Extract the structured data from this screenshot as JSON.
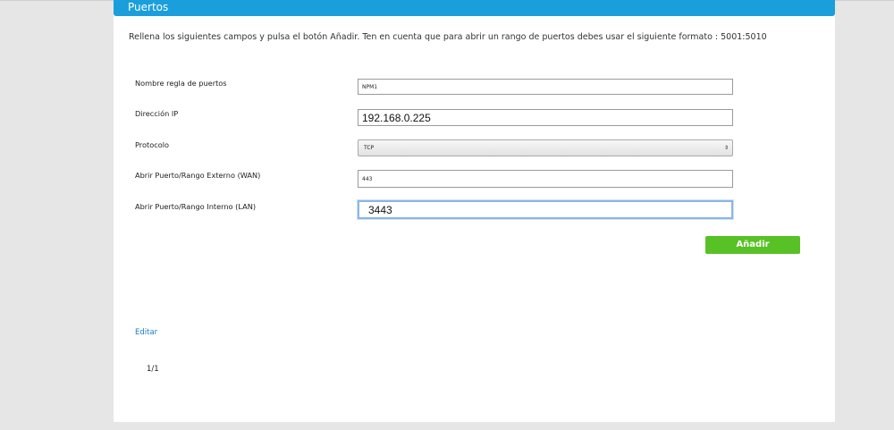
{
  "header": {
    "title": "Puertos"
  },
  "intro_text": "Rellena los siguientes campos y pulsa el botón Añadir. Ten en cuenta que para abrir un rango de puertos debes usar el siguiente formato : 5001:5010",
  "form": {
    "rule_name": {
      "label": "Nombre regla de puertos",
      "value": "NPM1"
    },
    "ip_address": {
      "label": "Dirección IP",
      "value": "192.168.0.225"
    },
    "protocol": {
      "label": "Protocolo",
      "selected": "TCP",
      "arrow": "⇕"
    },
    "external_port": {
      "label": "Abrir Puerto/Rango Externo (WAN)",
      "value": "443"
    },
    "internal_port": {
      "label": "Abrir Puerto/Rango Interno (LAN)",
      "value": "3443"
    },
    "add_button": "Añadir"
  },
  "edit_link": "Editar",
  "pagination": "1/1",
  "colors": {
    "header": "#1b9fdc",
    "add_button": "#58c126",
    "link": "#1b7fc4"
  }
}
